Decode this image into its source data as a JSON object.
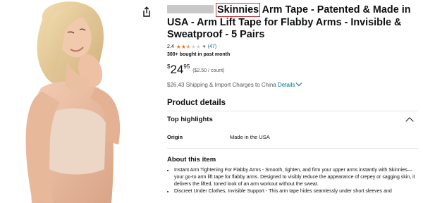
{
  "product": {
    "title_highlight": "Skinnies",
    "title_rest": " Arm Tape - Patented & Made in USA - Arm Lift Tape for Flabby Arms - Invisible & Sweatproof - 5 Pairs",
    "rating": "2.4",
    "stars_full": 2,
    "stars_half": 1,
    "stars_total": 5,
    "rating_count": "(47)",
    "bought": "300+ bought in past month",
    "price_symbol": "$",
    "price_whole": "24",
    "price_fraction": "95",
    "unit_price": "($2.50 / count)",
    "shipping_text": "$26.43 Shipping & Import Charges to China",
    "shipping_link": "Details"
  },
  "sections": {
    "product_details": "Product details",
    "top_highlights": "Top highlights",
    "origin_label": "Origin",
    "origin_value": "Made in the USA",
    "about_title": "About this item",
    "about_items": [
      "Instant Arm Tightening For Flabby Arms - Smooth, tighten, and firm your upper arms instantly with Skinnies—your go-to arm lift tape for flabby arms. Designed to visibly reduce the appearance of crepey or sagging skin, it delivers the lifted, toned look of an arm workout without the sweat.",
      "Discreet Under Clothes, Invisible Support - This arm tape hides seamlessly under short sleeves and"
    ]
  },
  "colors": {
    "link": "#007185",
    "star": "#de7921",
    "highlight_box": "#c0393b"
  },
  "icons": {
    "share": "share-icon",
    "collapse": "chevron-up-icon"
  }
}
